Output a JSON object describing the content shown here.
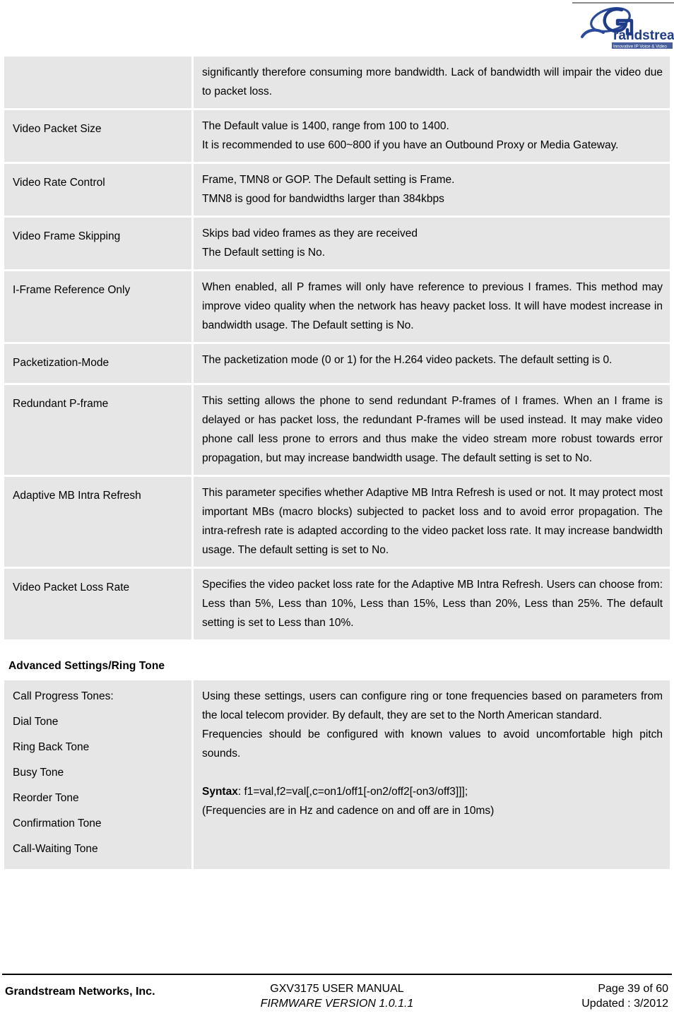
{
  "header": {
    "logo_name": "Grandstream",
    "logo_text": "randstream",
    "logo_tagline": "Innovative IP Voice & Video"
  },
  "tables": [
    {
      "id": "video-settings",
      "rows": [
        {
          "name_lines": [],
          "desc_lines": [
            "significantly therefore consuming more bandwidth. Lack of bandwidth will impair the video due to packet loss."
          ]
        },
        {
          "name_lines": [
            "Video Packet Size"
          ],
          "desc_lines": [
            "The Default value is 1400, range from 100 to 1400.",
            "It is recommended to use 600~800 if you have an Outbound Proxy or Media Gateway."
          ]
        },
        {
          "name_lines": [
            "Video Rate Control"
          ],
          "desc_lines": [
            "Frame, TMN8 or GOP. The Default setting is Frame.",
            "TMN8 is good for bandwidths larger than 384kbps"
          ]
        },
        {
          "name_lines": [
            "Video Frame Skipping"
          ],
          "desc_lines": [
            "Skips bad video frames as they are received",
            "The Default setting is No."
          ]
        },
        {
          "name_lines": [
            "I-Frame Reference Only"
          ],
          "desc_lines": [
            "When enabled, all P frames will only have reference to previous I frames. This method may improve video quality when the network has heavy packet loss. It will have modest increase in bandwidth usage. The Default setting is No."
          ]
        },
        {
          "name_lines": [
            "Packetization-Mode"
          ],
          "desc_lines": [
            "The packetization mode (0 or 1) for the H.264 video packets. The default setting is 0."
          ]
        },
        {
          "name_lines": [
            "Redundant P-frame"
          ],
          "desc_lines": [
            "This setting allows the phone to send redundant P-frames of I frames. When an I frame is delayed or has packet loss, the redundant P-frames will be used instead. It may make video phone call less prone to errors and thus make the video stream more robust towards error propagation, but may increase bandwidth usage. The default setting is set to No."
          ]
        },
        {
          "name_lines": [
            "Adaptive MB Intra Refresh"
          ],
          "desc_lines": [
            "This parameter specifies whether Adaptive MB Intra Refresh is used or not. It may protect most important MBs (macro blocks) subjected to packet loss and to avoid error propagation. The intra-refresh rate is adapted according to the video packet loss rate. It may increase bandwidth usage. The default setting is set to No."
          ]
        },
        {
          "name_lines": [
            "Video Packet Loss Rate"
          ],
          "desc_lines": [
            "Specifies the video packet loss rate for the Adaptive MB Intra Refresh. Users can choose from: Less than 5%, Less than 10%, Less than 15%, Less than 20%, Less than 25%. The default setting is set to Less than 10%."
          ]
        }
      ]
    }
  ],
  "section": {
    "heading": "Advanced Settings/Ring Tone",
    "row": {
      "name_lines": [
        "Call Progress Tones:",
        "Dial Tone",
        "Ring Back Tone",
        "Busy Tone",
        "Reorder Tone",
        "Confirmation Tone",
        "Call-Waiting Tone"
      ],
      "desc_para_1": "Using these settings, users can configure ring or tone frequencies based on parameters from the local telecom provider. By default, they are set to the North American standard.",
      "desc_para_2": "Frequencies should be configured with known values to avoid uncomfortable high pitch sounds.",
      "syntax_label": "Syntax",
      "syntax_value": ": f1=val,f2=val[,c=on1/off1[-on2/off2[-on3/off3]]];",
      "desc_para_3": "(Frequencies are in Hz and cadence on and off are in 10ms)"
    }
  },
  "footer": {
    "company": "Grandstream Networks, Inc.",
    "manual_title": "GXV3175 USER MANUAL",
    "firmware": "FIRMWARE VERSION 1.0.1.1",
    "page": "Page 39 of 60",
    "updated": "Updated : 3/2012"
  },
  "colors": {
    "cell_background": "#e6e6e6",
    "page_background": "#ffffff",
    "logo_blue": "#1f3c88",
    "footer_rule": "#000000"
  }
}
